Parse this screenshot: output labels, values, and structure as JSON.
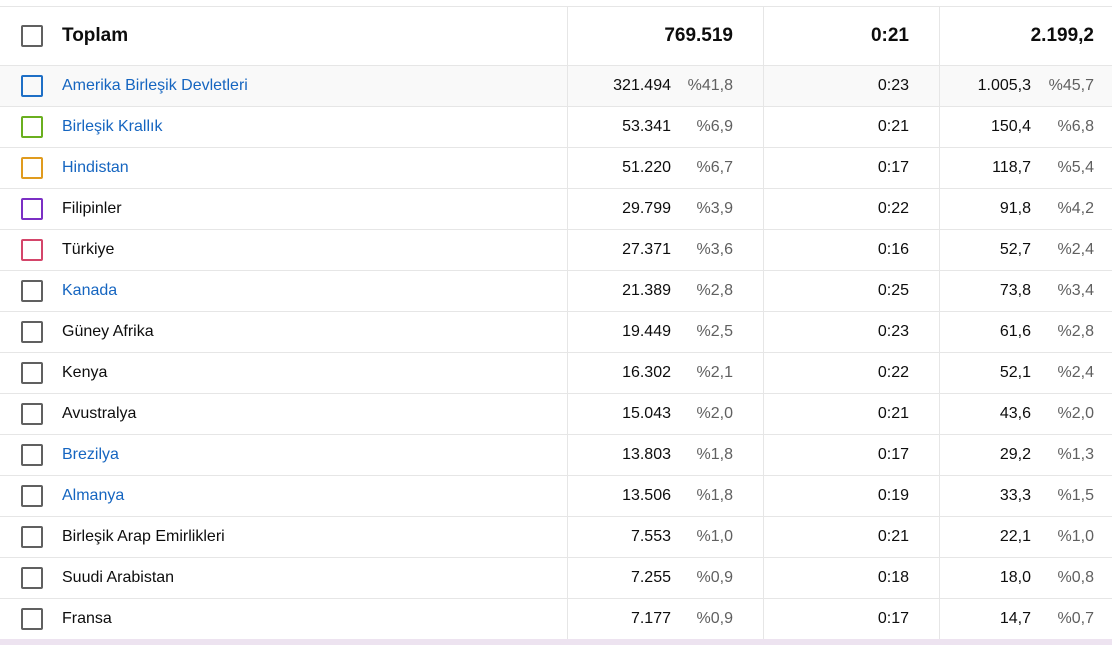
{
  "total": {
    "label": "Toplam",
    "views": "769.519",
    "avg_duration": "0:21",
    "watch_time": "2.199,2"
  },
  "rows": [
    {
      "name": "Amerika Birleşik Devletleri",
      "is_link": true,
      "checkbox_color": "#1e6fc6",
      "views": "321.494",
      "views_pct": "%41,8",
      "avg_duration": "0:23",
      "watch_time": "1.005,3",
      "watch_pct": "%45,7"
    },
    {
      "name": "Birleşik Krallık",
      "is_link": true,
      "checkbox_color": "#6aaf1f",
      "views": "53.341",
      "views_pct": "%6,9",
      "avg_duration": "0:21",
      "watch_time": "150,4",
      "watch_pct": "%6,8"
    },
    {
      "name": "Hindistan",
      "is_link": true,
      "checkbox_color": "#e09b1e",
      "views": "51.220",
      "views_pct": "%6,7",
      "avg_duration": "0:17",
      "watch_time": "118,7",
      "watch_pct": "%5,4"
    },
    {
      "name": "Filipinler",
      "is_link": false,
      "checkbox_color": "#7b2fc4",
      "views": "29.799",
      "views_pct": "%3,9",
      "avg_duration": "0:22",
      "watch_time": "91,8",
      "watch_pct": "%4,2"
    },
    {
      "name": "Türkiye",
      "is_link": false,
      "checkbox_color": "#d4456a",
      "views": "27.371",
      "views_pct": "%3,6",
      "avg_duration": "0:16",
      "watch_time": "52,7",
      "watch_pct": "%2,4"
    },
    {
      "name": "Kanada",
      "is_link": true,
      "checkbox_color": "#606060",
      "views": "21.389",
      "views_pct": "%2,8",
      "avg_duration": "0:25",
      "watch_time": "73,8",
      "watch_pct": "%3,4"
    },
    {
      "name": "Güney Afrika",
      "is_link": false,
      "checkbox_color": "#606060",
      "views": "19.449",
      "views_pct": "%2,5",
      "avg_duration": "0:23",
      "watch_time": "61,6",
      "watch_pct": "%2,8"
    },
    {
      "name": "Kenya",
      "is_link": false,
      "checkbox_color": "#606060",
      "views": "16.302",
      "views_pct": "%2,1",
      "avg_duration": "0:22",
      "watch_time": "52,1",
      "watch_pct": "%2,4"
    },
    {
      "name": "Avustralya",
      "is_link": false,
      "checkbox_color": "#606060",
      "views": "15.043",
      "views_pct": "%2,0",
      "avg_duration": "0:21",
      "watch_time": "43,6",
      "watch_pct": "%2,0"
    },
    {
      "name": "Brezilya",
      "is_link": true,
      "checkbox_color": "#606060",
      "views": "13.803",
      "views_pct": "%1,8",
      "avg_duration": "0:17",
      "watch_time": "29,2",
      "watch_pct": "%1,3"
    },
    {
      "name": "Almanya",
      "is_link": true,
      "checkbox_color": "#606060",
      "views": "13.506",
      "views_pct": "%1,8",
      "avg_duration": "0:19",
      "watch_time": "33,3",
      "watch_pct": "%1,5"
    },
    {
      "name": "Birleşik Arap Emirlikleri",
      "is_link": false,
      "checkbox_color": "#606060",
      "views": "7.553",
      "views_pct": "%1,0",
      "avg_duration": "0:21",
      "watch_time": "22,1",
      "watch_pct": "%1,0"
    },
    {
      "name": "Suudi Arabistan",
      "is_link": false,
      "checkbox_color": "#606060",
      "views": "7.255",
      "views_pct": "%0,9",
      "avg_duration": "0:18",
      "watch_time": "18,0",
      "watch_pct": "%0,8"
    },
    {
      "name": "Fransa",
      "is_link": false,
      "checkbox_color": "#606060",
      "views": "7.177",
      "views_pct": "%0,9",
      "avg_duration": "0:17",
      "watch_time": "14,7",
      "watch_pct": "%0,7"
    }
  ],
  "colors": {
    "link": "#1565c0",
    "text": "#0d0d0d",
    "muted": "#606060",
    "divider": "#e6e6e6",
    "highlight_row": "#f9f9f9"
  }
}
